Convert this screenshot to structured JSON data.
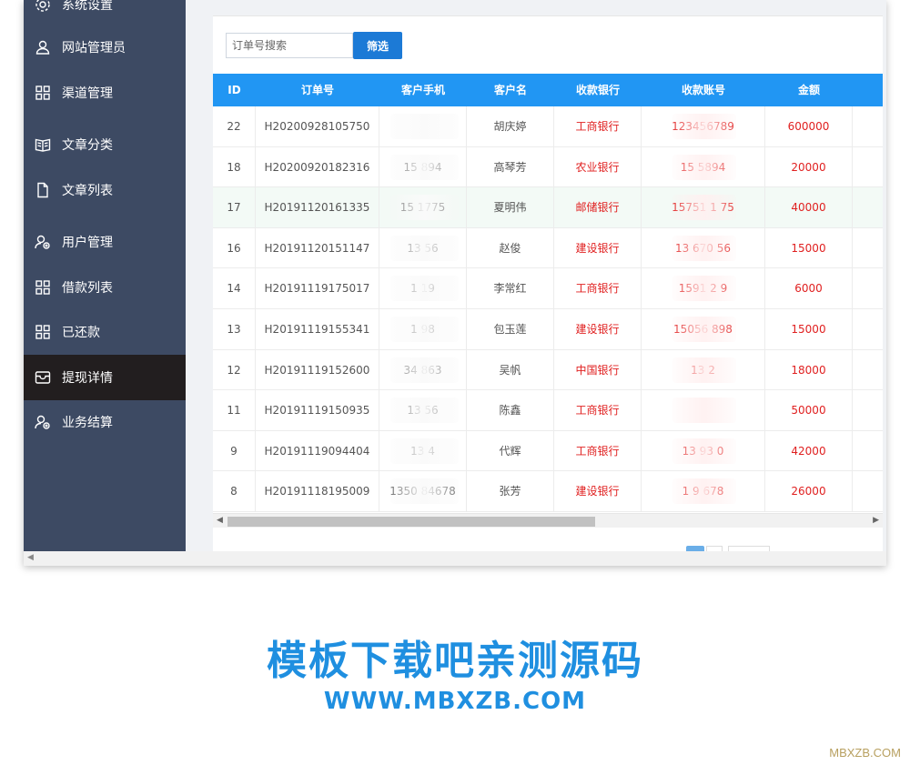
{
  "sidebar": {
    "items": [
      {
        "label": "系统设置",
        "icon": "gear-icon"
      },
      {
        "label": "网站管理员",
        "icon": "user-icon"
      },
      {
        "label": "渠道管理",
        "icon": "grid-icon"
      },
      {
        "label": "文章分类",
        "icon": "book-icon"
      },
      {
        "label": "文章列表",
        "icon": "document-icon"
      },
      {
        "label": "用户管理",
        "icon": "users-icon"
      },
      {
        "label": "借款列表",
        "icon": "grid-icon"
      },
      {
        "label": "已还款",
        "icon": "grid-icon"
      },
      {
        "label": "提现详情",
        "icon": "inbox-icon",
        "active": true
      },
      {
        "label": "业务结算",
        "icon": "users-icon"
      }
    ]
  },
  "search": {
    "placeholder": "订单号搜索",
    "button_label": "筛选"
  },
  "table": {
    "headers": [
      "ID",
      "订单号",
      "客户手机",
      "客户名",
      "收款银行",
      "收款账号",
      "金额"
    ],
    "rows": [
      {
        "id": "22",
        "order": "H20200928105750",
        "phone": "",
        "name": "胡庆婷",
        "bank": "工商银行",
        "account": "123456789",
        "amount": "600000"
      },
      {
        "id": "18",
        "order": "H20200920182316",
        "phone": "15       894",
        "name": "高琴芳",
        "bank": "农业银行",
        "account": "15      5894",
        "amount": "20000"
      },
      {
        "id": "17",
        "order": "H20191120161335",
        "phone": "15     1775",
        "name": "夏明伟",
        "bank": "邮储银行",
        "account": "15751   1 75",
        "amount": "40000"
      },
      {
        "id": "16",
        "order": "H20191120151147",
        "phone": "13      56",
        "name": "赵俊",
        "bank": "建设银行",
        "account": "13 670   56",
        "amount": "15000"
      },
      {
        "id": "14",
        "order": "H20191119175017",
        "phone": "1      19",
        "name": "李常红",
        "bank": "工商银行",
        "account": "1591   2  9",
        "amount": "6000"
      },
      {
        "id": "13",
        "order": "H20191119155341",
        "phone": "1      98",
        "name": "包玉莲",
        "bank": "建设银行",
        "account": "15056   898",
        "amount": "15000"
      },
      {
        "id": "12",
        "order": "H20191119152600",
        "phone": "34     863",
        "name": "吴帆",
        "bank": "中国银行",
        "account": "13       2",
        "amount": "18000"
      },
      {
        "id": "11",
        "order": "H20191119150935",
        "phone": "13     56",
        "name": "陈鑫",
        "bank": "工商银行",
        "account": "",
        "amount": "50000"
      },
      {
        "id": "9",
        "order": "H20191119094404",
        "phone": "13     4",
        "name": "代辉",
        "bank": "工商银行",
        "account": "13 93     0",
        "amount": "42000"
      },
      {
        "id": "8",
        "order": "H20191118195009",
        "phone": "1350  84678",
        "name": "张芳",
        "bank": "建设银行",
        "account": "1    9  678",
        "amount": "26000"
      }
    ]
  },
  "promo": {
    "title": "模板下载吧亲测源码",
    "url": "WWW.MBXZB.COM"
  },
  "watermark": "MBXZB.COM",
  "colors": {
    "sidebar_bg": "#3d4a63",
    "header_bg": "#2196f3",
    "accent": "#1c7ad6",
    "red_text": "#e02020"
  }
}
